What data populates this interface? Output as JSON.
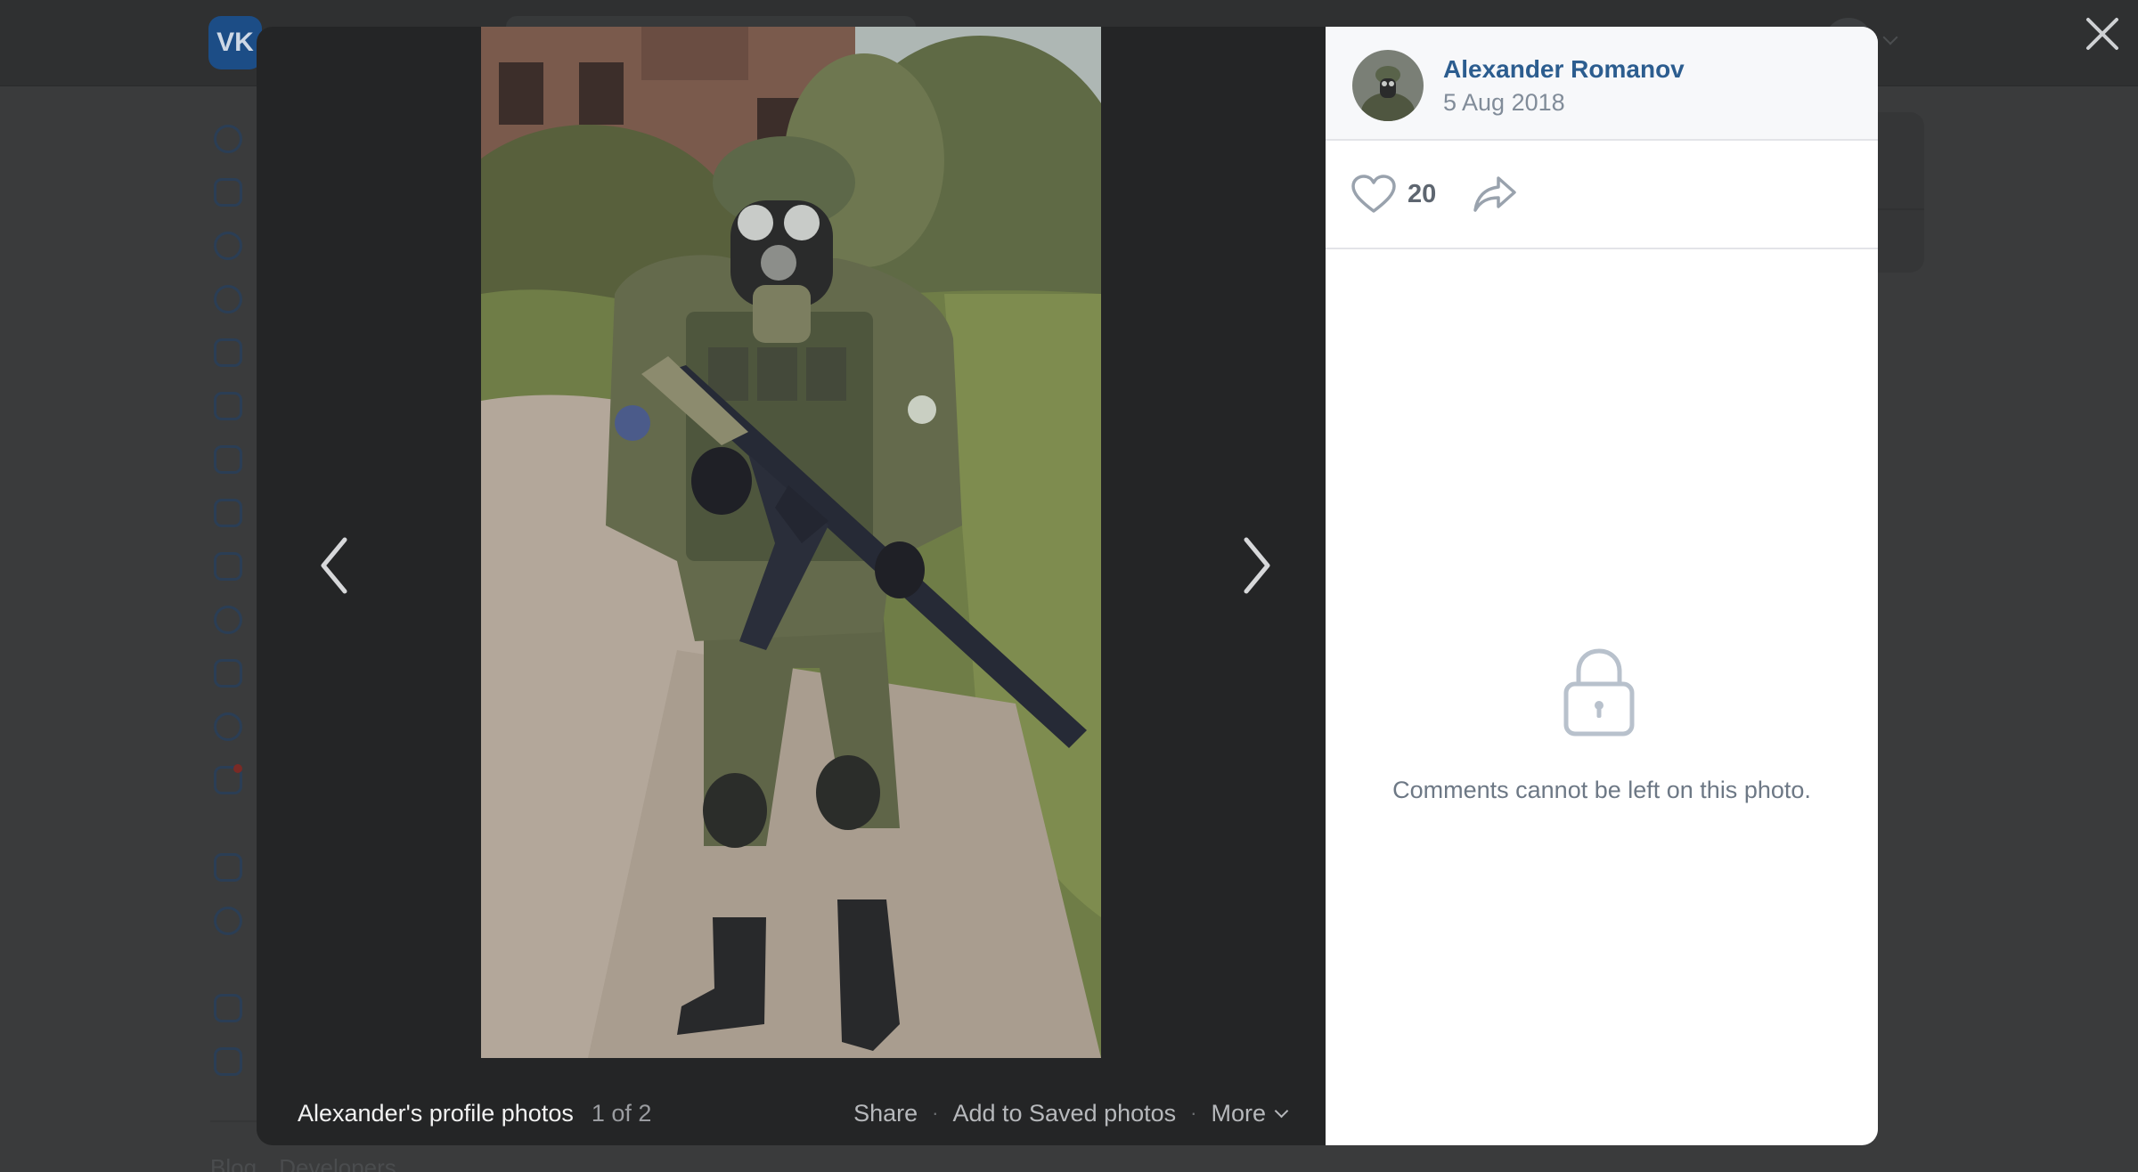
{
  "background": {
    "logo_text": "VK",
    "footer_links": [
      "Blog",
      "Developers"
    ]
  },
  "viewer": {
    "album_title": "Alexander's profile photos",
    "counter": "1 of 2",
    "actions": {
      "share": "Share",
      "save": "Add to Saved photos",
      "more": "More"
    },
    "separator": "·"
  },
  "info": {
    "author_name": "Alexander Romanov",
    "date": "5 Aug 2018",
    "likes": "20",
    "comments_disabled_text": "Comments cannot be left on this photo."
  },
  "colors": {
    "link": "#2c5d8f",
    "muted": "#818c99",
    "viewer_bg": "#242526"
  }
}
